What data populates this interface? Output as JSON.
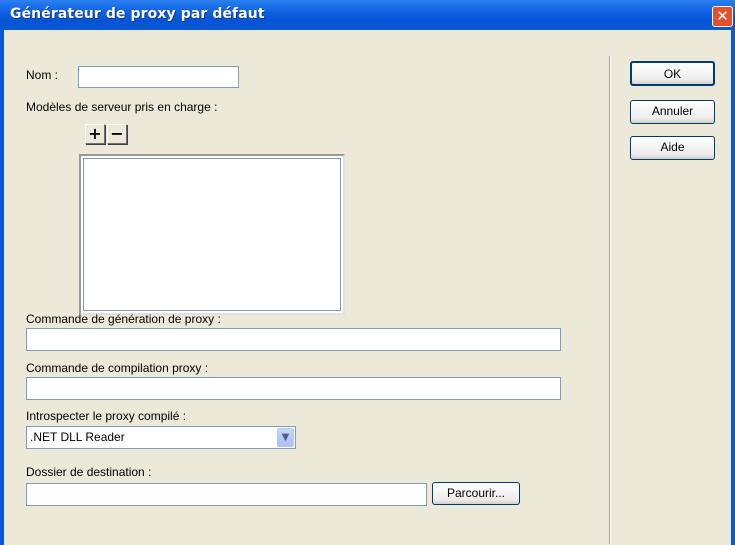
{
  "window": {
    "title": "Générateur de proxy par défaut",
    "close_glyph": "✕"
  },
  "form": {
    "nom_label": "Nom :",
    "nom_value": "",
    "models_label": "Modèles de serveur pris en charge :",
    "add_glyph": "+",
    "remove_glyph": "−",
    "models_list": [],
    "generation_label": "Commande de génération de proxy :",
    "generation_value": "",
    "compilation_label": "Commande de compilation proxy :",
    "compilation_value": "",
    "introspect_label": "Introspecter le proxy compilé :",
    "introspect_selected": ".NET DLL Reader",
    "destination_label": "Dossier de destination :",
    "destination_value": "",
    "browse_label": "Parcourir..."
  },
  "buttons": {
    "ok": "OK",
    "cancel": "Annuler",
    "help": "Aide"
  },
  "icons": {
    "dropdown": "chevron-down-icon",
    "close": "close-icon"
  }
}
